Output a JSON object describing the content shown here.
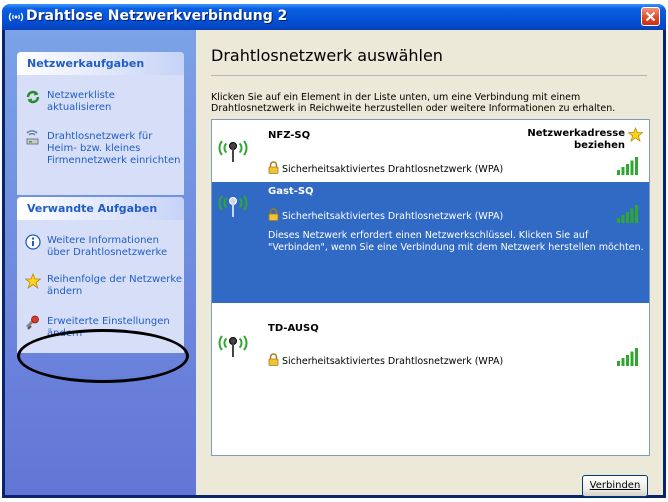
{
  "window": {
    "title": "Drahtlose Netzwerkverbindung 2"
  },
  "sidebar": {
    "network_tasks": {
      "header": "Netzwerkaufgaben",
      "items": [
        {
          "label": "Netzwerkliste aktualisieren",
          "icon": "refresh-icon"
        },
        {
          "label": "Drahtlosnetzwerk für Heim- bzw. kleines Firmennetzwerk einrichten",
          "icon": "wireless-setup-icon"
        }
      ]
    },
    "related_tasks": {
      "header": "Verwandte Aufgaben",
      "items": [
        {
          "label": "Weitere Informationen über Drahtlosnetzwerke",
          "icon": "info-icon"
        },
        {
          "label": "Reihenfolge der Netzwerke ändern",
          "icon": "star-icon"
        },
        {
          "label": "Erweiterte Einstellungen ändern",
          "icon": "settings-icon"
        }
      ]
    }
  },
  "main": {
    "title": "Drahtlosnetzwerk auswählen",
    "description": "Klicken Sie auf ein Element in der Liste unten, um eine Verbindung mit einem Drahtlosnetzwerk in Reichweite herzustellen oder weitere Informationen zu erhalten.",
    "networks": [
      {
        "name": "NFZ-SQ",
        "security": "Sicherheitsaktiviertes Drahtlosnetzwerk (WPA)",
        "badge_line1": "Netzwerkadresse",
        "badge_line2": "beziehen",
        "signal_bars": 5,
        "selected": false
      },
      {
        "name": "Gast-SQ",
        "security": "Sicherheitsaktiviertes Drahtlosnetzwerk (WPA)",
        "details": "Dieses Netzwerk erfordert einen Netzwerkschlüssel. Klicken Sie auf \"Verbinden\", wenn Sie eine Verbindung mit dem Netzwerk herstellen möchten.",
        "signal_bars": 5,
        "selected": true
      },
      {
        "name": "TD-AUSQ",
        "security": "Sicherheitsaktiviertes Drahtlosnetzwerk (WPA)",
        "signal_bars": 5,
        "selected": false
      }
    ],
    "connect_button": "Verbinden"
  },
  "colors": {
    "title_bar": "#0553d8",
    "sidebar_link": "#215dc6",
    "selection": "#316ac5",
    "signal": "#2fa82f"
  }
}
